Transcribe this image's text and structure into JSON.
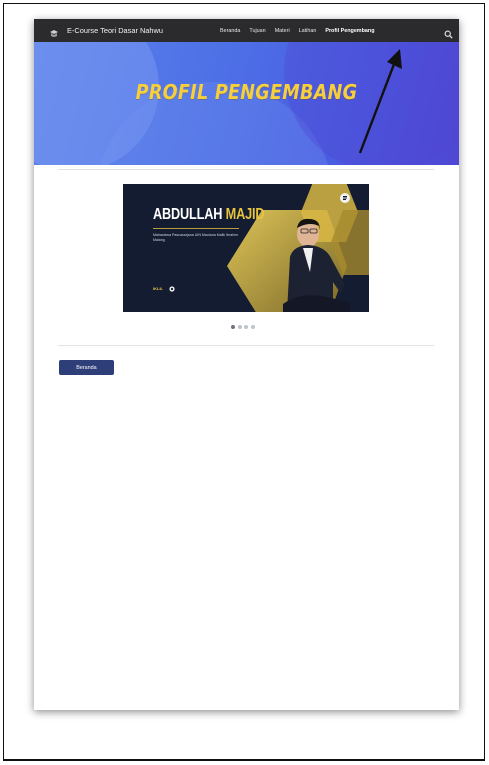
{
  "navbar": {
    "site_title": "E-Course Teori Dasar Nahwu",
    "links": [
      "Beranda",
      "Tujuan",
      "Materi",
      "Latihan",
      "Profil Pengembang"
    ],
    "active_link": "Profil Pengembang"
  },
  "hero": {
    "title": "PROFIL PENGEMBANG",
    "title_color": "#f6cf3a"
  },
  "carousel": {
    "slide": {
      "name_first": "ABDULLAH",
      "name_last": "MAJID",
      "subtitle": "Mahasiswa Pascasarjana UIN Maulana Malik Ibrahim Malang",
      "tag": "IKLIL"
    },
    "slide_count": 4,
    "active_index": 0
  },
  "content": {
    "home_button_label": "Beranda"
  },
  "colors": {
    "navbar_bg": "#2b2b2d",
    "button_bg": "#2d3e78",
    "banner_bg": "#131c30",
    "accent_gold": "#e8c33e"
  }
}
